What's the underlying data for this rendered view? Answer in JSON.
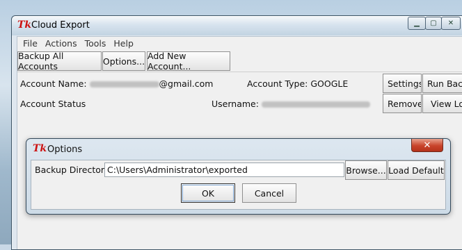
{
  "window": {
    "title": "Cloud Export",
    "app_icon": "Tk"
  },
  "menu": [
    "File",
    "Actions",
    "Tools",
    "Help"
  ],
  "toolbar": {
    "backup_all": "Backup All Accounts",
    "options": "Options...",
    "add_account": "Add New Account..."
  },
  "account": {
    "name_label": "Account Name:",
    "name_suffix": "@gmail.com",
    "type_label": "Account Type: GOOGLE",
    "status_label": "Account Status",
    "username_label": "Username:",
    "settings_btn": "Settings",
    "run_backup_btn": "Run Backup",
    "remove_btn": "Remove",
    "view_log_btn": "View Log"
  },
  "options_dialog": {
    "title": "Options",
    "app_icon": "Tk",
    "dir_label": "Backup Directory:",
    "dir_value": "C:\\Users\\Administrator\\exported",
    "browse_btn": "Browse...",
    "load_default_btn": "Load Default",
    "ok_btn": "OK",
    "cancel_btn": "Cancel"
  }
}
